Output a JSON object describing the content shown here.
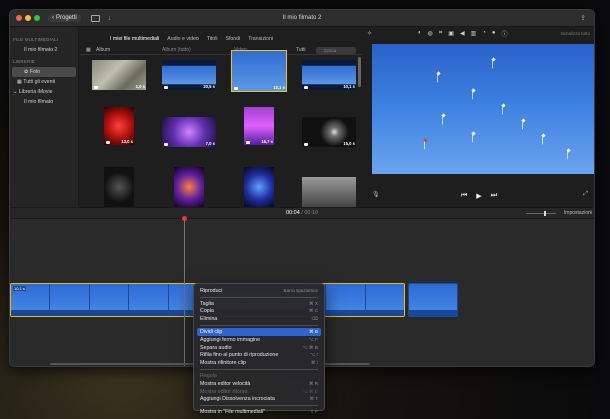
{
  "window": {
    "title": "Il mio filmato 2",
    "back_label": "Progetti"
  },
  "sidebar": {
    "section1": "FILE MULTIMEDIALI",
    "project": "Il mio filmato 2",
    "section2": "LIBRERIE",
    "items": [
      {
        "label": "Foto",
        "selected": true
      },
      {
        "label": "Tutti gli eventi",
        "selected": false
      }
    ],
    "library": "Libreria iMovie",
    "library_item": "Il mio filmato"
  },
  "browser": {
    "tabs": [
      "I miei file multimediali",
      "Audio e video",
      "Titoli",
      "Sfondi",
      "Transizioni"
    ],
    "active_tab": 0,
    "filter_album": "Album",
    "filter_album_all": "Album (tutto)",
    "filter_video": "Video",
    "filter_all": "Tutti",
    "search_placeholder": "Cerca",
    "thumbs": [
      {
        "dur": "1,0 s",
        "kind": "aerial"
      },
      {
        "dur": "20,5 s",
        "kind": "sky"
      },
      {
        "dur": "10,1 s",
        "kind": "sky",
        "selected": true
      },
      {
        "dur": "10,1 s",
        "kind": "sky"
      },
      {
        "dur": "13,0 s",
        "kind": "red"
      },
      {
        "dur": "7,0 s",
        "kind": "purple"
      },
      {
        "dur": "16,7 s",
        "kind": "violet"
      },
      {
        "dur": "15,0 s",
        "kind": "dark"
      },
      {
        "dur": "",
        "kind": "darkdots"
      },
      {
        "dur": "",
        "kind": "fireworks"
      },
      {
        "dur": "",
        "kind": "bluelight"
      },
      {
        "dur": "",
        "kind": "gray"
      }
    ]
  },
  "viewer": {
    "reset_label": "Inizializza tutto"
  },
  "timeline": {
    "timecode_current": "00:04",
    "timecode_sep": " / ",
    "timecode_total": "00:10",
    "settings_label": "Impostazioni",
    "clip_label": "10,1 s"
  },
  "context_menu": {
    "header": {
      "label": "Riproduci",
      "shortcut": "Barra spaziatrice"
    },
    "group1": [
      {
        "label": "Taglia",
        "shortcut": "⌘ X"
      },
      {
        "label": "Copia",
        "shortcut": "⌘ C"
      },
      {
        "label": "Elimina",
        "shortcut": "⌫"
      }
    ],
    "group2": [
      {
        "label": "Dividi clip",
        "shortcut": "⌘ B",
        "highlighted": true
      },
      {
        "label": "Aggiungi fermo immagine",
        "shortcut": "⌥ F"
      },
      {
        "label": "Separa audio",
        "shortcut": "⌥ ⌘ B"
      },
      {
        "label": "Rifila fino al punto di riproduzione",
        "shortcut": "⌥ /"
      },
      {
        "label": "Mostra rifinitore clip",
        "shortcut": "⌘ \\"
      }
    ],
    "group3_header": "Regola",
    "group3": [
      {
        "label": "Mostra editor velocità",
        "shortcut": "⌘ R",
        "disabled": false
      },
      {
        "label": "Mostra editor ritorno",
        "shortcut": "⌥ ⌘ E",
        "disabled": true
      },
      {
        "label": "Aggiungi Dissolvenza incrociata",
        "shortcut": "⌘ T",
        "disabled": false
      }
    ],
    "footer": {
      "label": "Mostra in \"File multimediali\"",
      "shortcut": "⇧ F"
    }
  }
}
